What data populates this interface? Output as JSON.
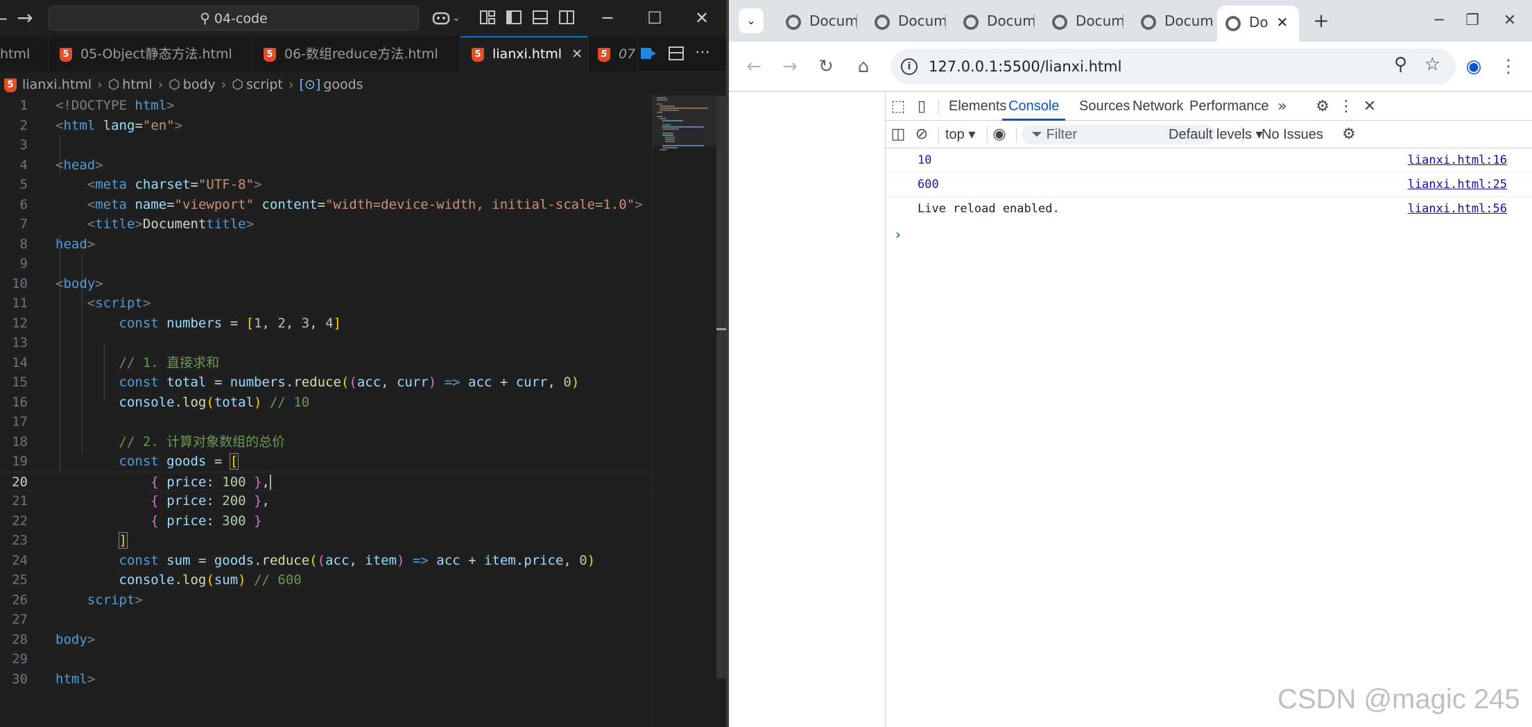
{
  "vscode": {
    "search_text": "04-code",
    "tabs": [
      {
        "label": "html"
      },
      {
        "label": "05-Object静态方法.html"
      },
      {
        "label": "06-数组reduce方法.html"
      },
      {
        "label": "lianxi.html",
        "close": "✕"
      },
      {
        "label": "07"
      }
    ],
    "breadcrumb": [
      "lianxi.html",
      "html",
      "body",
      "script",
      "goods"
    ],
    "line_numbers": [
      "1",
      "2",
      "3",
      "4",
      "5",
      "6",
      "7",
      "8",
      "9",
      "10",
      "11",
      "12",
      "13",
      "14",
      "15",
      "16",
      "17",
      "18",
      "19",
      "20",
      "21",
      "22",
      "23",
      "24",
      "25",
      "26",
      "27",
      "28",
      "29",
      "30"
    ],
    "code": {
      "doctype": "<!DOCTYPE",
      "html_word": "html",
      "lang_attr": "lang",
      "lang_val": "\"en\"",
      "head": "head",
      "meta": "meta",
      "charset_attr": "charset",
      "charset_val": "\"UTF-8\"",
      "name_attr": "name",
      "name_val": "\"viewport\"",
      "content_attr": "content",
      "content_val": "\"width=device-width, initial-scale=1.0\"",
      "title_tag": "title",
      "title_text": "Document",
      "body": "body",
      "script": "script",
      "const": "const",
      "numbers": "numbers",
      "arr_1": "1",
      "arr_2": "2",
      "arr_3": "3",
      "arr_4": "4",
      "comment1": "// 1. 直接求和",
      "total": "total",
      "reduce": "reduce",
      "acc": "acc",
      "curr": "curr",
      "zero": "0",
      "console": "console",
      "log": "log",
      "cm10": "// 10",
      "comment2": "// 2. 计算对象数组的总价",
      "goods": "goods",
      "price": "price",
      "p100": "100",
      "p200": "200",
      "p300": "300",
      "sum": "sum",
      "item": "item",
      "cm600": "// 600"
    }
  },
  "chrome": {
    "tabs": [
      {
        "label": "Docum"
      },
      {
        "label": "Docum"
      },
      {
        "label": "Docum"
      },
      {
        "label": "Docum"
      },
      {
        "label": "Docum"
      },
      {
        "label": "Do",
        "close": "✕"
      }
    ],
    "url": "127.0.0.1:5500/lianxi.html",
    "devtools": {
      "tabs": [
        "Elements",
        "Console",
        "Sources",
        "Network",
        "Performance"
      ],
      "active_tab": "Console",
      "context": "top ▾",
      "filter_placeholder": "Filter",
      "levels": "Default levels ▾",
      "issues": "No Issues",
      "messages": [
        {
          "text": "10",
          "source": "lianxi.html:16",
          "kind": "number"
        },
        {
          "text": "600",
          "source": "lianxi.html:25",
          "kind": "number"
        },
        {
          "text": "Live reload enabled.",
          "source": "lianxi.html:56",
          "kind": "text"
        }
      ],
      "prompt": "›"
    }
  },
  "watermark": "CSDN @magic 245",
  "colors": {
    "editor_bg": "#1f1f1f",
    "accent": "#0078d4",
    "console_active": "#0b57d0",
    "html_icon": "#e44d26"
  }
}
